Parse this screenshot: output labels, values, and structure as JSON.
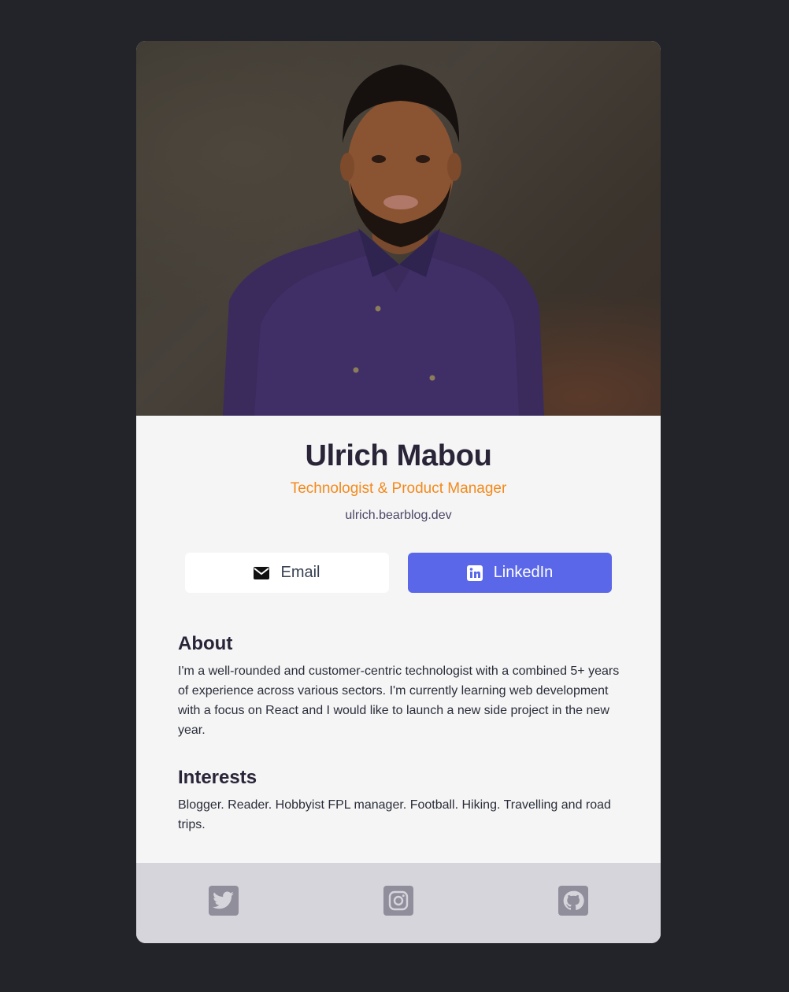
{
  "profile": {
    "name": "Ulrich Mabou",
    "title": "Technologist & Product Manager",
    "website": "ulrich.bearblog.dev"
  },
  "buttons": {
    "email_label": "Email",
    "linkedin_label": "LinkedIn"
  },
  "about": {
    "heading": "About",
    "text": "I'm a well-rounded and customer-centric technologist with a combined 5+ years of experience across various sectors. I'm currently learning web development with a focus on React and I would like to launch a new side project in the new year."
  },
  "interests": {
    "heading": "Interests",
    "text": "Blogger. Reader. Hobbyist FPL manager. Football. Hiking. Travelling and road trips."
  },
  "footer": {
    "icons": [
      "twitter-icon",
      "instagram-icon",
      "github-icon"
    ]
  },
  "colors": {
    "page_background": "#23242a",
    "card_background": "#f5f5f5",
    "accent_orange": "#f38a1c",
    "linkedin_blue": "#5a67e8",
    "footer_background": "#d6d5db",
    "icon_gray": "#918e9c"
  }
}
